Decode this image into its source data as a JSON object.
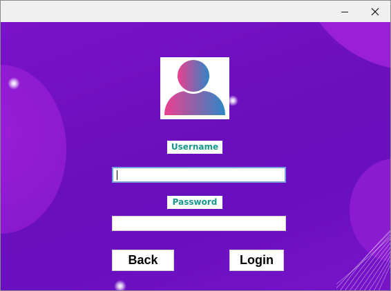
{
  "window": {
    "minimize_icon": "minimize-icon",
    "close_icon": "close-icon"
  },
  "avatar": {
    "icon": "user-avatar-icon",
    "gradient_start": "#ec3f8f",
    "gradient_end": "#2f86c6"
  },
  "form": {
    "username_label": "Username",
    "username_value": "",
    "password_label": "Password",
    "password_value": ""
  },
  "buttons": {
    "back_label": "Back",
    "login_label": "Login"
  },
  "colors": {
    "background": "#6b0fbd",
    "label_text": "#16968f",
    "focus_border": "#7a9fe0"
  }
}
